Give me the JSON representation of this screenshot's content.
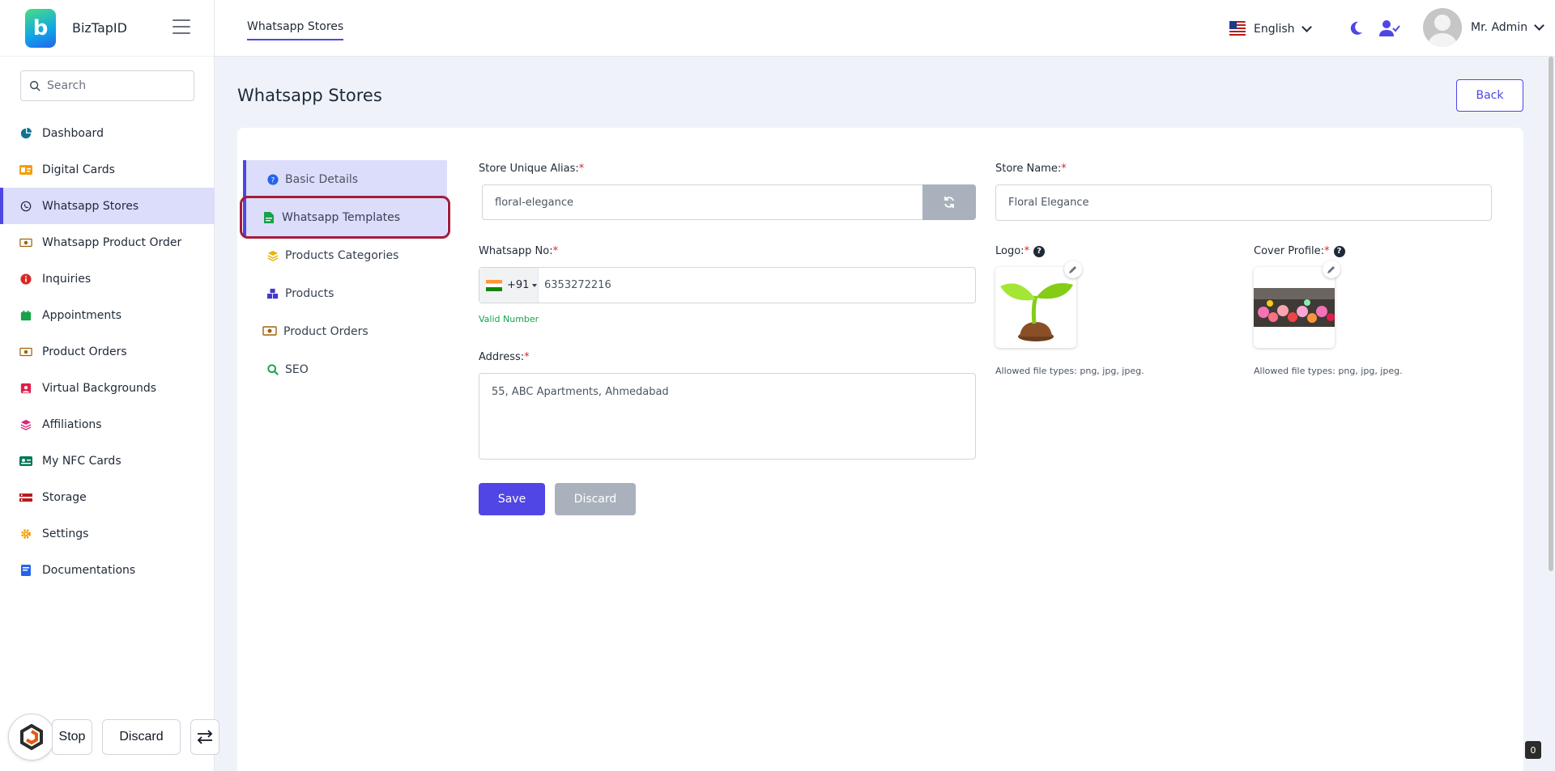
{
  "brand": {
    "name": "BizTapID"
  },
  "sidebar": {
    "search_placeholder": "Search",
    "items": [
      {
        "label": "Dashboard",
        "icon": "dashboard-icon",
        "color": "#0e7490"
      },
      {
        "label": "Digital Cards",
        "icon": "id-card-icon",
        "color": "#f59e0b"
      },
      {
        "label": "Whatsapp Stores",
        "icon": "whatsapp-icon",
        "color": "#1f2937",
        "active": true
      },
      {
        "label": "Whatsapp Product Order",
        "icon": "money-icon",
        "color": "#a16207"
      },
      {
        "label": "Inquiries",
        "icon": "info-icon",
        "color": "#dc2626"
      },
      {
        "label": "Appointments",
        "icon": "calendar-icon",
        "color": "#16a34a"
      },
      {
        "label": "Product Orders",
        "icon": "money-icon",
        "color": "#a16207"
      },
      {
        "label": "Virtual Backgrounds",
        "icon": "image-icon",
        "color": "#e11d48"
      },
      {
        "label": "Affiliations",
        "icon": "layers-icon",
        "color": "#db2777"
      },
      {
        "label": "My NFC Cards",
        "icon": "nfc-card-icon",
        "color": "#047857"
      },
      {
        "label": "Storage",
        "icon": "storage-icon",
        "color": "#b91c1c"
      },
      {
        "label": "Settings",
        "icon": "gear-icon",
        "color": "#f59e0b"
      },
      {
        "label": "Documentations",
        "icon": "book-icon",
        "color": "#2563eb"
      }
    ]
  },
  "floating_toolbar": {
    "stop_label": "Stop",
    "discard_label": "Discard"
  },
  "topbar": {
    "tab_label": "Whatsapp Stores",
    "language": "English",
    "user_name": "Mr. Admin"
  },
  "page": {
    "title": "Whatsapp Stores",
    "back_label": "Back"
  },
  "side_tabs": [
    {
      "label": "Basic Details",
      "icon": "question-circle-icon"
    },
    {
      "label": "Whatsapp Templates",
      "icon": "document-icon"
    },
    {
      "label": "Products Categories",
      "icon": "layers-icon"
    },
    {
      "label": "Products",
      "icon": "boxes-icon"
    },
    {
      "label": "Product Orders",
      "icon": "money-icon"
    },
    {
      "label": "SEO",
      "icon": "search-icon"
    }
  ],
  "form": {
    "alias_label": "Store Unique Alias:",
    "alias_value": "floral-elegance",
    "store_name_label": "Store Name:",
    "store_name_value": "Floral Elegance",
    "whatsapp_label": "Whatsapp No:",
    "country_code": "+91",
    "phone_value": "6353272216",
    "valid_text": "Valid Number",
    "address_label": "Address:",
    "address_value": "55, ABC Apartments, Ahmedabad",
    "logo_label": "Logo:",
    "cover_label": "Cover Profile:",
    "allowed_types": "Allowed file types: png, jpg, jpeg.",
    "save_label": "Save",
    "discard_label": "Discard",
    "required_mark": "*"
  },
  "colors": {
    "primary": "#4f46e5",
    "active_bg": "#dcdcfb",
    "required": "#dc2626",
    "valid": "#16a34a",
    "highlight": "#a31d3b"
  },
  "badge": "0"
}
